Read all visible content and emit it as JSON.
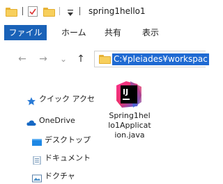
{
  "window": {
    "title": "spring1hello1"
  },
  "ribbon": {
    "tabs": [
      {
        "label": "ファイル"
      },
      {
        "label": "ホーム"
      },
      {
        "label": "共有"
      },
      {
        "label": "表示"
      }
    ]
  },
  "navigation": {
    "back_glyph": "←",
    "forward_glyph": "→",
    "recent_glyph": "⌄",
    "up_glyph": "↑",
    "address": "C:¥pleiades¥workspac"
  },
  "sidebar": {
    "items": [
      {
        "label": "クイック アクセ",
        "icon": "star-icon"
      },
      {
        "label": "OneDrive",
        "icon": "cloud-icon"
      },
      {
        "label": "デスクトップ",
        "icon": "desktop-folder-icon"
      },
      {
        "label": "ドキュメント",
        "icon": "document-icon"
      },
      {
        "label": "ドクチャ",
        "icon": "pictures-icon"
      }
    ]
  },
  "files": [
    {
      "name": "Spring1hello1Application.java",
      "icon": "intellij-idea-icon"
    }
  ],
  "colors": {
    "accent": "#1a62b8",
    "selection": "#1f6ad2",
    "folder": "#f7cf5c"
  }
}
